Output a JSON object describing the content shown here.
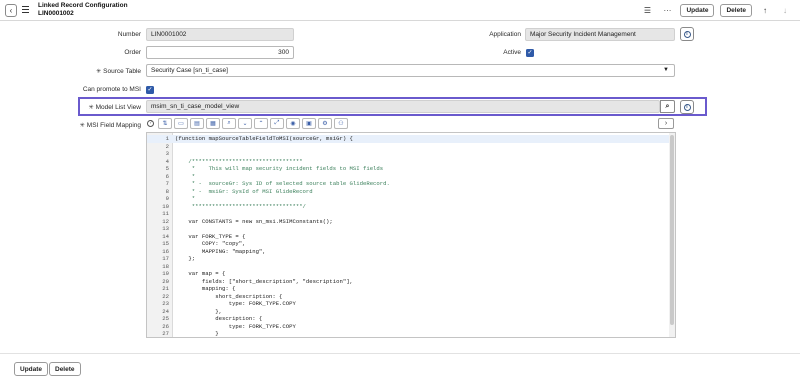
{
  "header": {
    "title": "Linked Record Configuration",
    "record_number": "LIN0001002",
    "update_label": "Update",
    "delete_label": "Delete"
  },
  "form": {
    "number": {
      "label": "Number",
      "value": "LIN0001002"
    },
    "order": {
      "label": "Order",
      "value": "300"
    },
    "application": {
      "label": "Application",
      "value": "Major Security Incident Management"
    },
    "active": {
      "label": "Active",
      "checked": true
    },
    "source_table": {
      "label": "Source Table",
      "value": "Security Case [sn_ti_case]"
    },
    "can_promote": {
      "label": "Can promote to MSI",
      "checked": true
    },
    "model_list_view": {
      "label": "Model List View",
      "value": "msim_sn_ti_case_model_view"
    },
    "msi_field_mapping": {
      "label": "MSI Field Mapping"
    }
  },
  "code_lines": [
    "(function mapSourceTableFieldToMSI(sourceGr, msiGr) {",
    "",
    "",
    "    /*********************************",
    "     *    This will map security incident fields to MSI fields",
    "     *",
    "     * -  sourceGr: Sys ID of selected source table GlideRecord.",
    "     * -  msiGr: SysId of MSI GlideRecord",
    "     *",
    "     *********************************/",
    "",
    "    var CONSTANTS = new sn_msi.MSIMConstants();",
    "",
    "    var FORK_TYPE = {",
    "        COPY: \"copy\",",
    "        MAPPING: \"mapping\",",
    "    };",
    "",
    "    var map = {",
    "        fields: [\"short_description\", \"description\"],",
    "        mapping: {",
    "            short_description: {",
    "                type: FORK_TYPE.COPY",
    "            },",
    "            description: {",
    "                type: FORK_TYPE.COPY",
    "            }"
  ],
  "footer": {
    "update_label": "Update",
    "delete_label": "Delete"
  }
}
